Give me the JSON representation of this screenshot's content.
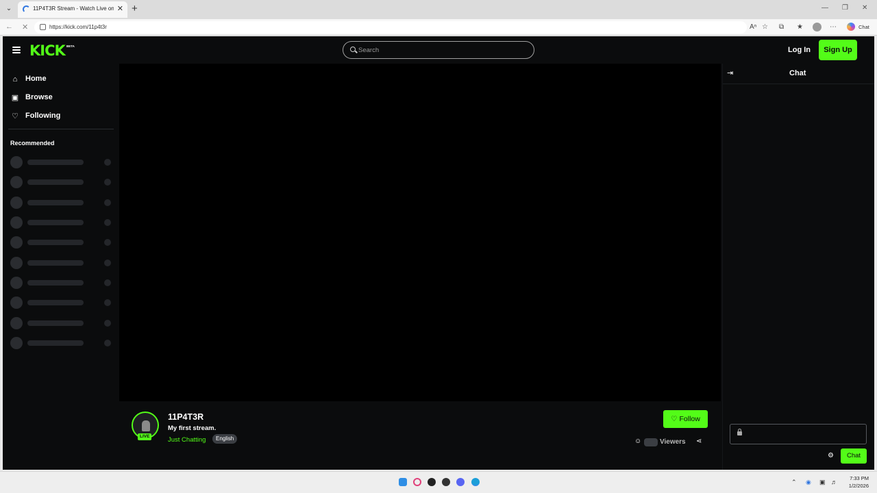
{
  "browser": {
    "tab_title": "11P4T3R Stream - Watch Live on K",
    "url": "https://kick.com/11p4t3r",
    "copilot_label": "Chat"
  },
  "header": {
    "logo": "KICK",
    "logo_badge": "BETA",
    "search_placeholder": "Search",
    "login_label": "Log In",
    "signup_label": "Sign Up"
  },
  "sidebar": {
    "items": [
      {
        "label": "Home",
        "icon": "home-icon"
      },
      {
        "label": "Browse",
        "icon": "browse-icon"
      },
      {
        "label": "Following",
        "icon": "heart-icon"
      }
    ],
    "recommended_heading": "Recommended",
    "recommended_placeholder_count": 10
  },
  "channel": {
    "name": "11P4T3R",
    "live_badge": "LIVE",
    "stream_title": "My first stream.",
    "category": "Just Chatting",
    "language": "English",
    "follow_label": "Follow",
    "viewers_label": "Viewers"
  },
  "chat": {
    "title": "Chat",
    "send_label": "Chat"
  },
  "taskbar": {
    "time": "7:33 PM",
    "date": "1/2/2026"
  },
  "colors": {
    "brand": "#53fc18",
    "background": "#0b0c0d"
  }
}
